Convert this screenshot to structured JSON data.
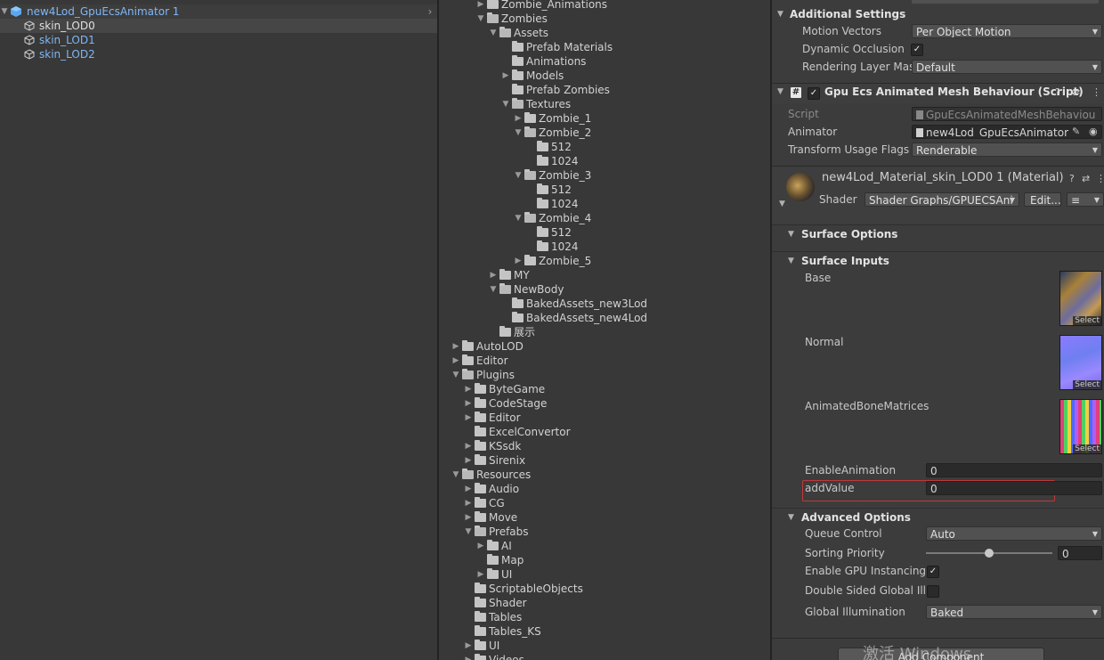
{
  "hierarchy": {
    "root": "new4Lod_GpuEcsAnimator 1",
    "children": [
      "skin_LOD0",
      "skin_LOD1",
      "skin_LOD2"
    ]
  },
  "project": {
    "items": [
      {
        "label": "Zombie_Animations",
        "depth": 2,
        "arrow": "right"
      },
      {
        "label": "Zombies",
        "depth": 2,
        "arrow": "down",
        "open": true
      },
      {
        "label": "Assets",
        "depth": 3,
        "arrow": "down",
        "open": true
      },
      {
        "label": "Prefab Materials",
        "depth": 4,
        "arrow": ""
      },
      {
        "label": "Animations",
        "depth": 4,
        "arrow": ""
      },
      {
        "label": "Models",
        "depth": 4,
        "arrow": "right"
      },
      {
        "label": "Prefab Zombies",
        "depth": 4,
        "arrow": ""
      },
      {
        "label": "Textures",
        "depth": 4,
        "arrow": "down",
        "open": true
      },
      {
        "label": "Zombie_1",
        "depth": 5,
        "arrow": "right"
      },
      {
        "label": "Zombie_2",
        "depth": 5,
        "arrow": "down",
        "open": true
      },
      {
        "label": "512",
        "depth": 6,
        "arrow": ""
      },
      {
        "label": "1024",
        "depth": 6,
        "arrow": ""
      },
      {
        "label": "Zombie_3",
        "depth": 5,
        "arrow": "down",
        "open": true
      },
      {
        "label": "512",
        "depth": 6,
        "arrow": ""
      },
      {
        "label": "1024",
        "depth": 6,
        "arrow": ""
      },
      {
        "label": "Zombie_4",
        "depth": 5,
        "arrow": "down",
        "open": true
      },
      {
        "label": "512",
        "depth": 6,
        "arrow": ""
      },
      {
        "label": "1024",
        "depth": 6,
        "arrow": ""
      },
      {
        "label": "Zombie_5",
        "depth": 5,
        "arrow": "right"
      },
      {
        "label": "MY",
        "depth": 3,
        "arrow": "right"
      },
      {
        "label": "NewBody",
        "depth": 3,
        "arrow": "down",
        "open": true
      },
      {
        "label": "BakedAssets_new3Lod",
        "depth": 4,
        "arrow": ""
      },
      {
        "label": "BakedAssets_new4Lod",
        "depth": 4,
        "arrow": ""
      },
      {
        "label": "展示",
        "depth": 3,
        "arrow": ""
      },
      {
        "label": "AutoLOD",
        "depth": 0,
        "arrow": "right"
      },
      {
        "label": "Editor",
        "depth": 0,
        "arrow": "right"
      },
      {
        "label": "Plugins",
        "depth": 0,
        "arrow": "down",
        "open": true
      },
      {
        "label": "ByteGame",
        "depth": 1,
        "arrow": "right"
      },
      {
        "label": "CodeStage",
        "depth": 1,
        "arrow": "right"
      },
      {
        "label": "Editor",
        "depth": 1,
        "arrow": "right"
      },
      {
        "label": "ExcelConvertor",
        "depth": 1,
        "arrow": ""
      },
      {
        "label": "KSsdk",
        "depth": 1,
        "arrow": "right"
      },
      {
        "label": "Sirenix",
        "depth": 1,
        "arrow": "right"
      },
      {
        "label": "Resources",
        "depth": 0,
        "arrow": "down",
        "open": true
      },
      {
        "label": "Audio",
        "depth": 1,
        "arrow": "right"
      },
      {
        "label": "CG",
        "depth": 1,
        "arrow": "right"
      },
      {
        "label": "Move",
        "depth": 1,
        "arrow": "right"
      },
      {
        "label": "Prefabs",
        "depth": 1,
        "arrow": "down",
        "open": true
      },
      {
        "label": "AI",
        "depth": 2,
        "arrow": "right"
      },
      {
        "label": "Map",
        "depth": 2,
        "arrow": ""
      },
      {
        "label": "UI",
        "depth": 2,
        "arrow": "right"
      },
      {
        "label": "ScriptableObjects",
        "depth": 1,
        "arrow": ""
      },
      {
        "label": "Shader",
        "depth": 1,
        "arrow": ""
      },
      {
        "label": "Tables",
        "depth": 1,
        "arrow": ""
      },
      {
        "label": "Tables_KS",
        "depth": 1,
        "arrow": ""
      },
      {
        "label": "UI",
        "depth": 1,
        "arrow": "right"
      },
      {
        "label": "Videos",
        "depth": 1,
        "arrow": "right"
      }
    ]
  },
  "inspector": {
    "additional_settings": {
      "title": "Additional Settings",
      "motion_vectors_label": "Motion Vectors",
      "motion_vectors_value": "Per Object Motion",
      "dynamic_occlusion_label": "Dynamic Occlusion",
      "rendering_layer_label": "Rendering Layer Mas",
      "rendering_layer_value": "Default"
    },
    "component": {
      "title": "Gpu Ecs Animated Mesh Behaviour (Script)",
      "script_label": "Script",
      "script_value": "GpuEcsAnimatedMeshBehaviou",
      "animator_label": "Animator",
      "animator_value": "new4Lod_GpuEcsAnimator",
      "transform_label": "Transform Usage Flags",
      "transform_value": "Renderable"
    },
    "material": {
      "title": "new4Lod_Material_skin_LOD0 1 (Material)",
      "shader_label": "Shader",
      "shader_value": "Shader Graphs/GPUECSAni",
      "edit_label": "Edit...",
      "list_icon": "≡"
    },
    "surface_options": "Surface Options",
    "surface_inputs": {
      "title": "Surface Inputs",
      "base": "Base",
      "normal": "Normal",
      "bone": "AnimatedBoneMatrices",
      "select": "Select",
      "enable_anim_label": "EnableAnimation",
      "enable_anim_value": "0",
      "add_value_label": "addValue",
      "add_value_value": "0"
    },
    "advanced": {
      "title": "Advanced Options",
      "queue_label": "Queue Control",
      "queue_value": "Auto",
      "sorting_label": "Sorting Priority",
      "sorting_value": "0",
      "sorting_fraction": 0.5,
      "gpu_inst_label": "Enable GPU Instancing",
      "double_sided_label": "Double Sided Global Illu",
      "gi_label": "Global Illumination",
      "gi_value": "Baked"
    },
    "add_component": "Add Component",
    "watermark": "激活 Windows"
  },
  "colors": {
    "accent_blue": "#7fb6f5",
    "highlight_red": "#c0393b"
  }
}
